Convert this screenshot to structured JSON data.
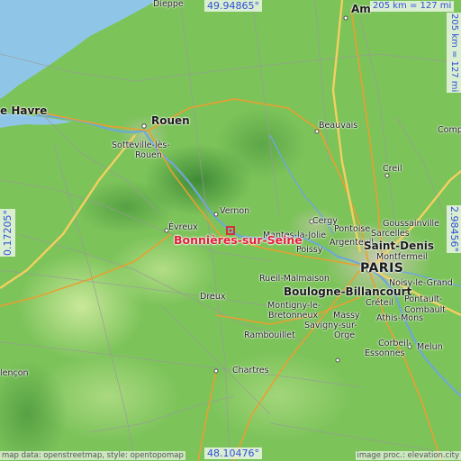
{
  "coords": {
    "top": "49.94865°",
    "bottom": "48.10476°",
    "left": "0.17205°",
    "right": "2.98456°"
  },
  "scale": {
    "horizontal": "205 km = 127 mi",
    "vertical": "205 km = 127 mi"
  },
  "highlight": "Bonnières-sur-Seine",
  "places": {
    "dieppe": "Dieppe",
    "amiens": "Am",
    "le_havre": "e Havre",
    "rouen": "Rouen",
    "sotteville": "Sotteville-lès-",
    "sotteville2": "Rouen",
    "beauvais": "Beauvais",
    "comp": "Comp",
    "creil": "Creil",
    "vernon": "Vernon",
    "evreux": "Évreux",
    "cergy": "Cergy",
    "pontoise": "Pontoise",
    "sarcelles": "Sarcelles",
    "goussainville": "Goussainville",
    "mantes": "Mantes-la-Jolie",
    "poissy": "Poissy",
    "argenteuil": "Argenteuil",
    "saint_denis": "Saint-Denis",
    "montfermeil": "Montfermeil",
    "paris": "PARIS",
    "noisy": "Noisy-le-Grand",
    "rueil": "Rueil-Malmaison",
    "boulogne": "Boulogne-Billancourt",
    "dreux": "Dreux",
    "creteil": "Créteil",
    "montigny": "Montigny-le-",
    "bretonneux": "Bretonneux",
    "massy": "Massy",
    "pontault": "Pontault-",
    "combault": "Combault",
    "athis": "Athis-Mons",
    "savigny": "Savigny-sur-",
    "orge": "Orge",
    "rambouillet": "Rambouillet",
    "corbeil": "Corbeil-",
    "essonnes": "Essonnes",
    "melun": "Melun",
    "chartres": "Chartres",
    "alencon": "lençon"
  },
  "credits": {
    "left": "map data: openstreetmap, style: opentopomap",
    "right": "image proc.: elevation.city"
  },
  "colors": {
    "terrain": "#7fc45a",
    "sea": "#8fc6e8",
    "highway": "#f0c040",
    "highlight": "#e0203a",
    "coord_text": "#2f4fd6"
  }
}
